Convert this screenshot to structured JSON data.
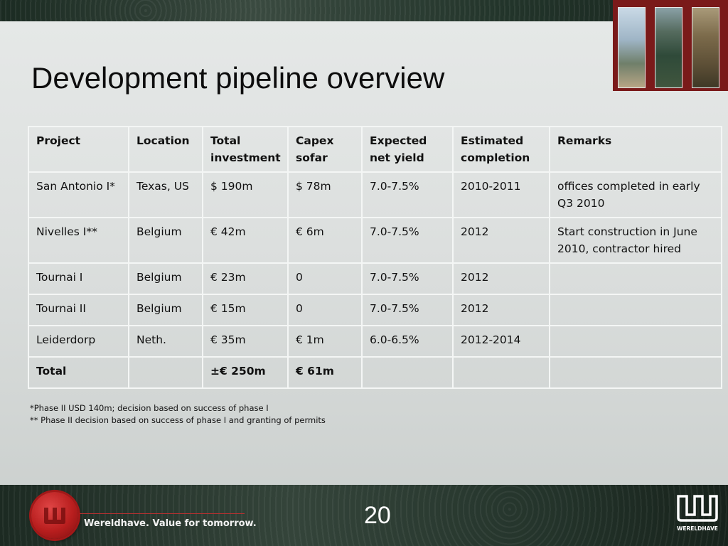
{
  "slide": {
    "title": "Development pipeline overview",
    "page_number": "20",
    "footer_tagline": "Wereldhave. Value for tomorrow.",
    "brand_logo_text": "WERELDHAVE"
  },
  "table": {
    "headers": {
      "project": "Project",
      "location": "Location",
      "total_investment": "Total investment",
      "capex_sofar": "Capex sofar",
      "expected_net_yield": "Expected net yield",
      "estimated_completion": "Estimated completion",
      "remarks": "Remarks"
    },
    "rows": [
      {
        "project": "San Antonio I*",
        "location": "Texas, US",
        "total_investment": "$ 190m",
        "capex_sofar": "$ 78m",
        "expected_net_yield": "7.0-7.5%",
        "estimated_completion": "2010-2011",
        "remarks": "offices completed in early Q3 2010"
      },
      {
        "project": "Nivelles I**",
        "location": "Belgium",
        "total_investment": "€ 42m",
        "capex_sofar": "€ 6m",
        "expected_net_yield": "7.0-7.5%",
        "estimated_completion": "2012",
        "remarks": "Start construction in June 2010, contractor hired"
      },
      {
        "project": "Tournai I",
        "location": "Belgium",
        "total_investment": "€ 23m",
        "capex_sofar": "0",
        "expected_net_yield": "7.0-7.5%",
        "estimated_completion": "2012",
        "remarks": ""
      },
      {
        "project": "Tournai II",
        "location": "Belgium",
        "total_investment": "€ 15m",
        "capex_sofar": "0",
        "expected_net_yield": "7.0-7.5%",
        "estimated_completion": "2012",
        "remarks": ""
      },
      {
        "project": "Leiderdorp",
        "location": "Neth.",
        "total_investment": "€ 35m",
        "capex_sofar": "€ 1m",
        "expected_net_yield": "6.0-6.5%",
        "estimated_completion": "2012-2014",
        "remarks": ""
      }
    ],
    "total": {
      "project": "Total",
      "location": "",
      "total_investment": "±€ 250m",
      "capex_sofar": "€ 61m",
      "expected_net_yield": "",
      "estimated_completion": "",
      "remarks": ""
    }
  },
  "footnotes": [
    "*Phase II USD 140m; decision based on success of phase I",
    "** Phase II decision based on success of phase I and granting of permits"
  ],
  "colors": {
    "slide_background": "#dcdfde",
    "table_border": "#f4f6f5",
    "band_dark_green": "#1c2a22",
    "seal_red": "#b81e1e"
  },
  "icons": {
    "seal": "wereldhave-wax-seal-icon",
    "brand": "wereldhave-logo-icon"
  }
}
